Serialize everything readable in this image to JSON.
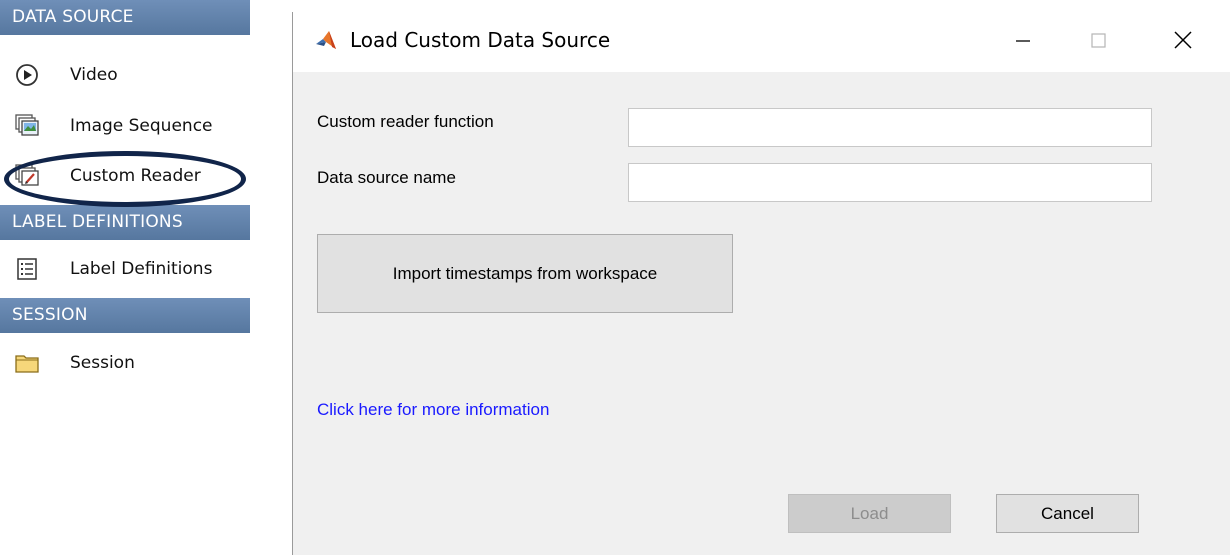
{
  "left_panel": {
    "sections": [
      {
        "header": "DATA SOURCE"
      },
      {
        "header": "LABEL DEFINITIONS"
      },
      {
        "header": "SESSION"
      }
    ],
    "items": [
      {
        "label": "Video",
        "icon": "play-circle-icon"
      },
      {
        "label": "Image Sequence",
        "icon": "image-stack-icon"
      },
      {
        "label": "Custom Reader",
        "icon": "custom-reader-icon"
      },
      {
        "label": "Label Definitions",
        "icon": "list-icon"
      },
      {
        "label": "Session",
        "icon": "folder-icon"
      }
    ],
    "highlighted_item": "Custom Reader",
    "header_color": "#5f80a9",
    "highlight_color": "#11254a"
  },
  "dialog": {
    "title": "Load Custom Data Source",
    "title_icon": "matlab-icon",
    "window_controls": [
      "minimize-icon",
      "maximize-icon",
      "close-icon"
    ],
    "fields": [
      {
        "label": "Custom reader function",
        "value": "",
        "placeholder": ""
      },
      {
        "label": "Data source name",
        "value": "",
        "placeholder": ""
      }
    ],
    "import_button": "Import timestamps from workspace",
    "info_link": "Click here for more information",
    "load_button": "Load",
    "load_enabled": false,
    "cancel_button": "Cancel",
    "link_color": "#1a1aff",
    "background_color": "#f0f0f0"
  }
}
